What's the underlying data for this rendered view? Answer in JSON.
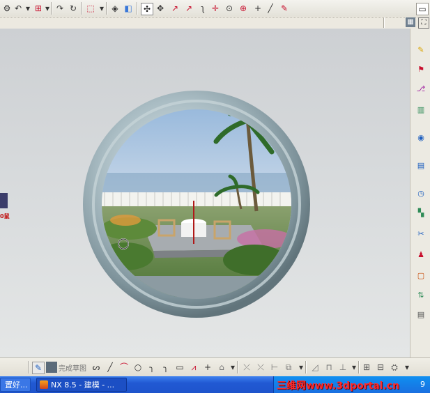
{
  "toolbar": {
    "icons": [
      "settings-icon",
      "undo-icon",
      "snap-icon",
      "move-icon",
      "select-box-icon",
      "shade-icon",
      "cube-icon",
      "filter-icon",
      "point-icon",
      "line-icon",
      "arc-icon",
      "curve-icon",
      "axis-icon",
      "circle-snap-icon",
      "target-icon",
      "cross-icon",
      "pencil-icon",
      "paint-icon"
    ]
  },
  "left_stub": {
    "text": "0鼠"
  },
  "bottom_toolbar": {
    "finish_sketch": "完成草图"
  },
  "taskbar": {
    "left_item": "置好...",
    "app_item": "NX 8.5 - 建模 - ...",
    "watermark": "三维网www.3dportal.cn",
    "clock": "9"
  },
  "colors": {
    "accent": "#2159d3",
    "watermark": "#ff2a2a",
    "ring": "#9fb1b8"
  }
}
